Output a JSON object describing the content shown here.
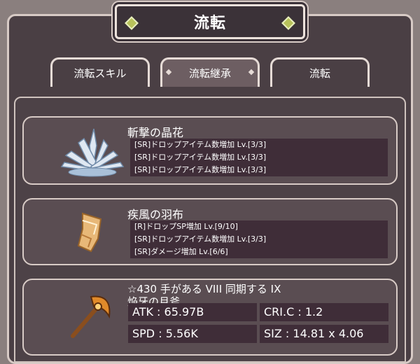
{
  "header": {
    "title": "流転"
  },
  "tabs": [
    {
      "label": "流転スキル",
      "active": false
    },
    {
      "label": "流転継承",
      "active": true
    },
    {
      "label": "流転",
      "active": false
    }
  ],
  "items": [
    {
      "name": "斬撃の晶花",
      "icon": "crystal-flower-icon",
      "stats": [
        "[SR]ドロップアイテム数増加 Lv.[3/3]",
        "[SR]ドロップアイテム数増加 Lv.[3/3]",
        "[SR]ドロップアイテム数増加 Lv.[3/3]"
      ]
    },
    {
      "name": "疾風の羽布",
      "icon": "wind-cloth-icon",
      "stats": [
        "[R]ドロップSP増加 Lv.[9/10]",
        "[SR]ドロップアイテム数増加 Lv.[3/3]",
        "[SR]ダメージ増加 Lv.[6/6]"
      ]
    }
  ],
  "weapon": {
    "rank_line": "☆430 手がある VIII 同期する IX",
    "name": "焔牙の月斧",
    "icon": "moon-axe-icon",
    "atk": "ATK : 65.97B",
    "cri": "CRI.C : 1.2",
    "spd": "SPD : 5.56K",
    "siz": "SIZ : 14.81 x 4.06"
  },
  "colors": {
    "panel": "#4a3f44",
    "border": "#d8cbc6",
    "stat_bg": "#3f2d38",
    "accent": "#b8c25a"
  }
}
